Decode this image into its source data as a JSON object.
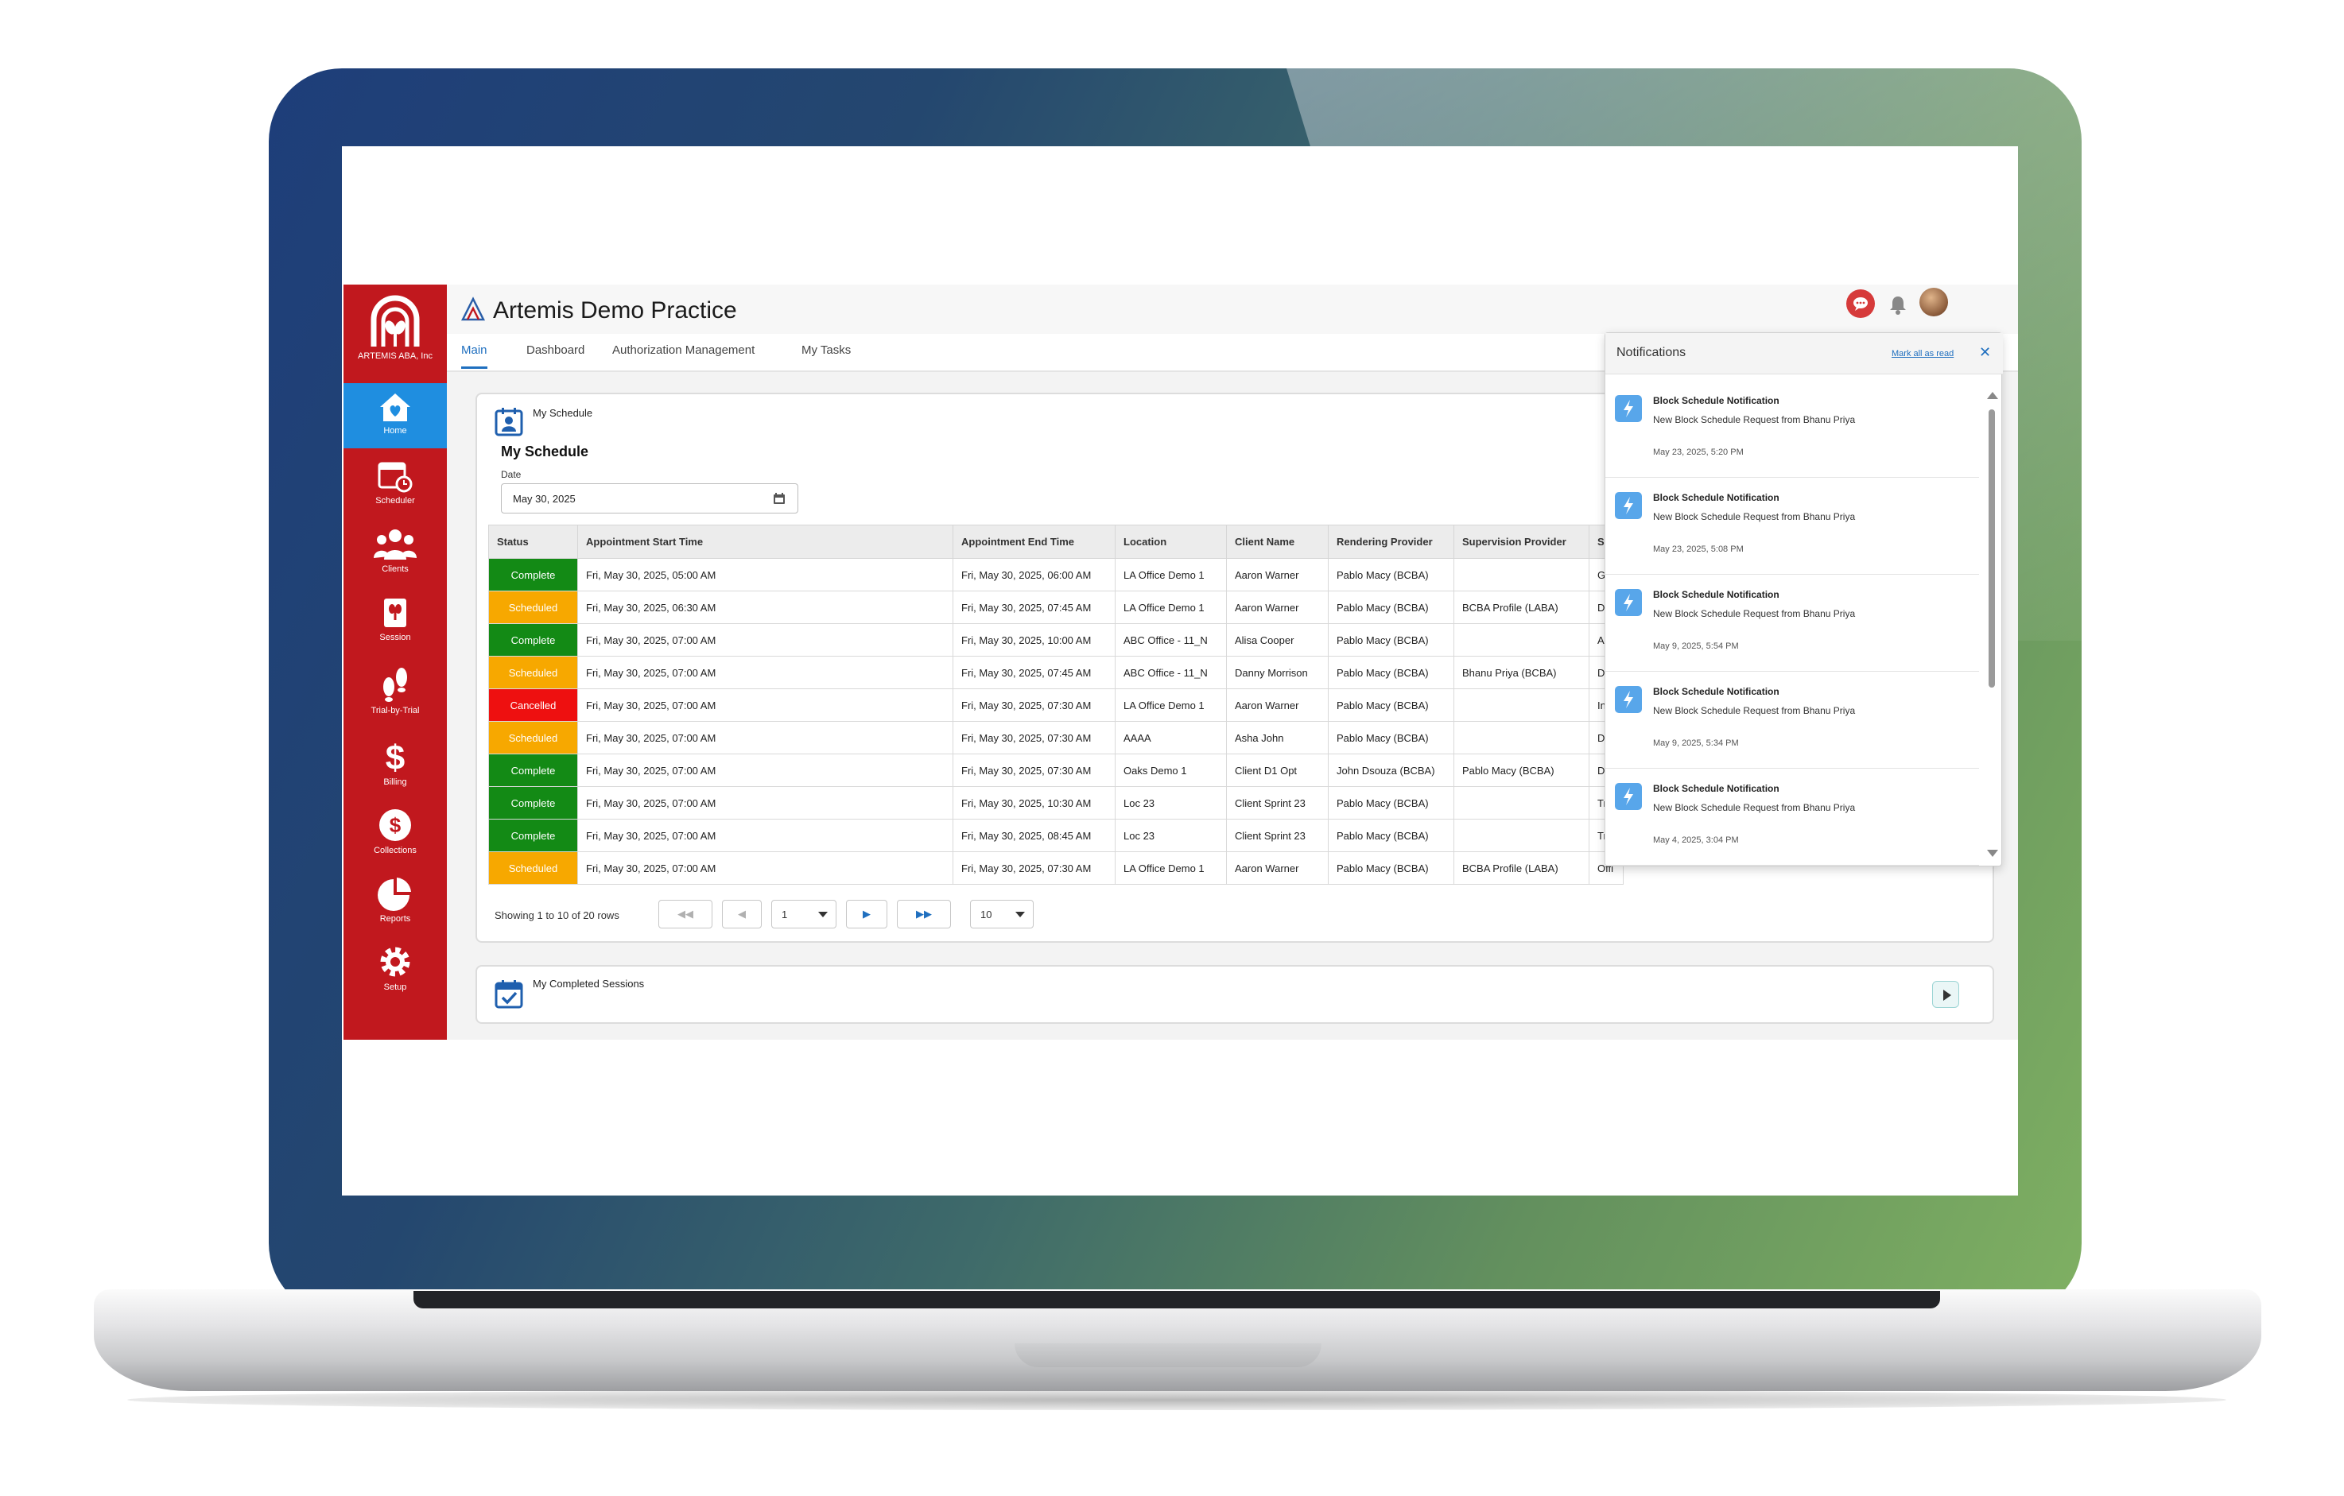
{
  "app": {
    "org_name": "ARTEMIS ABA, Inc",
    "title": "Artemis Demo Practice"
  },
  "sidebar": {
    "items": [
      {
        "label": "Home",
        "icon": "home-icon"
      },
      {
        "label": "Scheduler",
        "icon": "calendar-clock-icon"
      },
      {
        "label": "Clients",
        "icon": "people-icon"
      },
      {
        "label": "Session",
        "icon": "session-icon"
      },
      {
        "label": "Trial-by-Trial",
        "icon": "footprints-icon"
      },
      {
        "label": "Billing",
        "icon": "dollar-icon"
      },
      {
        "label": "Collections",
        "icon": "collections-icon"
      },
      {
        "label": "Reports",
        "icon": "pie-chart-icon"
      },
      {
        "label": "Setup",
        "icon": "gear-icon"
      }
    ],
    "active": "Home"
  },
  "tabs": [
    {
      "label": "Main",
      "active": true
    },
    {
      "label": "Dashboard",
      "active": false
    },
    {
      "label": "Authorization Management",
      "active": false
    },
    {
      "label": "My Tasks",
      "active": false
    }
  ],
  "schedule": {
    "crumb": "My Schedule",
    "title": "My Schedule",
    "date_label": "Date",
    "date_value": "May 30, 2025",
    "columns": [
      "Status",
      "Appointment Start Time",
      "Appointment End Time",
      "Location",
      "Client Name",
      "Rendering Provider",
      "Supervision Provider",
      "Ser"
    ],
    "rows": [
      {
        "status": "Complete",
        "start": "Fri, May 30, 2025, 05:00 AM",
        "end": "Fri, May 30, 2025, 06:00 AM",
        "location": "LA Office Demo 1",
        "client": "Aaron Warner",
        "rendering": "Pablo Macy (BCBA)",
        "supervision": "",
        "service": "Gro"
      },
      {
        "status": "Scheduled",
        "start": "Fri, May 30, 2025, 06:30 AM",
        "end": "Fri, May 30, 2025, 07:45 AM",
        "location": "LA Office Demo 1",
        "client": "Aaron Warner",
        "rendering": "Pablo Macy (BCBA)",
        "supervision": "BCBA Profile (LABA)",
        "service": "Dir"
      },
      {
        "status": "Complete",
        "start": "Fri, May 30, 2025, 07:00 AM",
        "end": "Fri, May 30, 2025, 10:00 AM",
        "location": "ABC Office - 11_N",
        "client": "Alisa Cooper",
        "rendering": "Pablo Macy (BCBA)",
        "supervision": "",
        "service": "Ass"
      },
      {
        "status": "Scheduled",
        "start": "Fri, May 30, 2025, 07:00 AM",
        "end": "Fri, May 30, 2025, 07:45 AM",
        "location": "ABC Office - 11_N",
        "client": "Danny Morrison",
        "rendering": "Pablo Macy (BCBA)",
        "supervision": "Bhanu Priya (BCBA)",
        "service": "Dir"
      },
      {
        "status": "Cancelled",
        "start": "Fri, May 30, 2025, 07:00 AM",
        "end": "Fri, May 30, 2025, 07:30 AM",
        "location": "LA Office Demo 1",
        "client": "Aaron Warner",
        "rendering": "Pablo Macy (BCBA)",
        "supervision": "",
        "service": "Init"
      },
      {
        "status": "Scheduled",
        "start": "Fri, May 30, 2025, 07:00 AM",
        "end": "Fri, May 30, 2025, 07:30 AM",
        "location": "AAAA",
        "client": "Asha John",
        "rendering": "Pablo Macy (BCBA)",
        "supervision": "",
        "service": "Dir"
      },
      {
        "status": "Complete",
        "start": "Fri, May 30, 2025, 07:00 AM",
        "end": "Fri, May 30, 2025, 07:30 AM",
        "location": "Oaks Demo 1",
        "client": "Client D1 Opt",
        "rendering": "John Dsouza (BCBA)",
        "supervision": "Pablo Macy (BCBA)",
        "service": "Dir"
      },
      {
        "status": "Complete",
        "start": "Fri, May 30, 2025, 07:00 AM",
        "end": "Fri, May 30, 2025, 10:30 AM",
        "location": "Loc 23",
        "client": "Client Sprint 23",
        "rendering": "Pablo Macy (BCBA)",
        "supervision": "",
        "service": "Trai"
      },
      {
        "status": "Complete",
        "start": "Fri, May 30, 2025, 07:00 AM",
        "end": "Fri, May 30, 2025, 08:45 AM",
        "location": "Loc 23",
        "client": "Client Sprint 23",
        "rendering": "Pablo Macy (BCBA)",
        "supervision": "",
        "service": "Trai"
      },
      {
        "status": "Scheduled",
        "start": "Fri, May 30, 2025, 07:00 AM",
        "end": "Fri, May 30, 2025, 07:30 AM",
        "location": "LA Office Demo 1",
        "client": "Aaron Warner",
        "rendering": "Pablo Macy (BCBA)",
        "supervision": "BCBA Profile (LABA)",
        "service": "Offi"
      }
    ],
    "pager": {
      "summary": "Showing 1 to 10 of 20 rows",
      "first": "◀◀",
      "prev": "◀",
      "page": "1",
      "next": "▶",
      "last": "▶▶",
      "page_size": "10"
    }
  },
  "completed": {
    "title": "My Completed Sessions"
  },
  "notifications": {
    "title": "Notifications",
    "mark_all": "Mark all as read",
    "close": "✕",
    "items": [
      {
        "title": "Block Schedule Notification",
        "body": "New Block Schedule Request from Bhanu Priya",
        "date": "May 23, 2025, 5:20 PM"
      },
      {
        "title": "Block Schedule Notification",
        "body": "New Block Schedule Request from Bhanu Priya",
        "date": "May 23, 2025, 5:08 PM"
      },
      {
        "title": "Block Schedule Notification",
        "body": "New Block Schedule Request from Bhanu Priya",
        "date": "May 9, 2025, 5:54 PM"
      },
      {
        "title": "Block Schedule Notification",
        "body": "New Block Schedule Request from Bhanu Priya",
        "date": "May 9, 2025, 5:34 PM"
      },
      {
        "title": "Block Schedule Notification",
        "body": "New Block Schedule Request from Bhanu Priya",
        "date": "May 4, 2025, 3:04 PM"
      }
    ]
  },
  "colors": {
    "sidebar": "#c1181e",
    "sidebar_active": "#1f8ee0",
    "complete": "#138a15",
    "scheduled": "#f7a800",
    "cancelled": "#ee1010",
    "accent": "#1f6fbf"
  }
}
